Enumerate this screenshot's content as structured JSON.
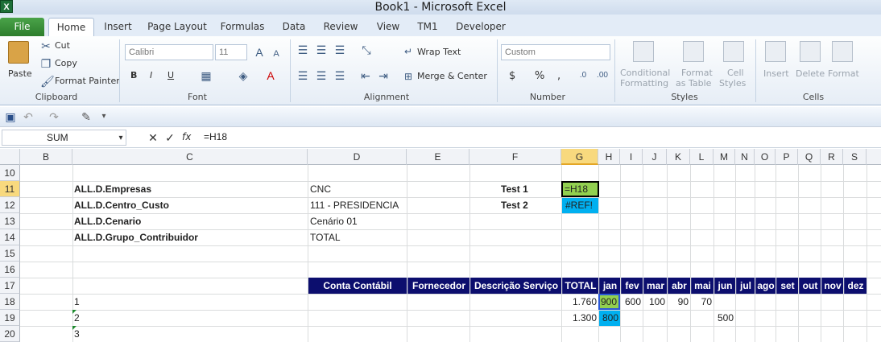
{
  "window": {
    "title": "Book1  -  Microsoft Excel",
    "logo": "X"
  },
  "tabs": [
    "File",
    "Home",
    "Insert",
    "Page Layout",
    "Formulas",
    "Data",
    "Review",
    "View",
    "TM1",
    "Developer"
  ],
  "ribbon": {
    "clipboard": {
      "label": "Clipboard",
      "paste": "Paste",
      "cut": "Cut",
      "copy": "Copy",
      "format_painter": "Format Painter"
    },
    "font": {
      "label": "Font",
      "name": "Calibri",
      "size": "11",
      "bold": "B",
      "italic": "I",
      "underline": "U"
    },
    "alignment": {
      "label": "Alignment",
      "wrap": "Wrap Text",
      "merge": "Merge & Center"
    },
    "number": {
      "label": "Number",
      "format": "Custom",
      "currency": "$",
      "percent": "%",
      "comma": ","
    },
    "styles": {
      "label": "Styles",
      "conditional": "Conditional",
      "conditional2": "Formatting",
      "format_as": "Format",
      "format_as2": "as Table",
      "cell_styles": "Cell",
      "cell_styles2": "Styles"
    },
    "cells": {
      "label": "Cells",
      "insert": "Insert",
      "delete": "Delete",
      "format": "Format"
    }
  },
  "formula_bar": {
    "name_box": "SUM",
    "fx": "fx",
    "formula": "=H18"
  },
  "columns": [
    "B",
    "C",
    "D",
    "E",
    "F",
    "G",
    "H",
    "I",
    "J",
    "K",
    "L",
    "M",
    "N",
    "O",
    "P",
    "Q",
    "R",
    "S"
  ],
  "rows": [
    "10",
    "11",
    "12",
    "13",
    "14",
    "15",
    "16",
    "17",
    "18",
    "19",
    "20"
  ],
  "cells": {
    "c11": "ALL.D.Empresas",
    "d11": "CNC",
    "f11": "Test 1",
    "g11": "=H18",
    "c12": "ALL.D.Centro_Custo",
    "d12": "111 - PRESIDENCIA",
    "f12": "Test 2",
    "g12": "#REF!",
    "c13": "ALL.D.Cenario",
    "d13": "Cenário 01",
    "c14": "ALL.D.Grupo_Contribuidor",
    "d14": "TOTAL",
    "h17": [
      "Conta Contábil",
      "Fornecedor",
      "Descrição Serviço",
      "TOTAL",
      "jan",
      "fev",
      "mar",
      "abr",
      "mai",
      "jun",
      "jul",
      "ago",
      "set",
      "out",
      "nov",
      "dez"
    ],
    "c18": "1",
    "g18": "1.760",
    "h18": "900",
    "i18": "600",
    "j18": "100",
    "k18": "90",
    "l18": "70",
    "c19": "2",
    "g19": "1.300",
    "h19": "800",
    "m19": "500",
    "c20": "3"
  },
  "colors": {
    "header_fill": "#0c0e6e",
    "highlight_green": "#92d050",
    "highlight_blue": "#00b0f0"
  }
}
